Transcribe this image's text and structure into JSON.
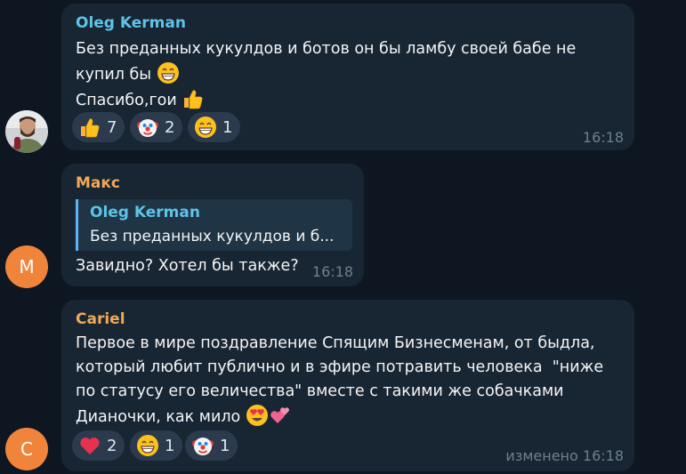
{
  "messages": [
    {
      "sender": "Oleg Kerman",
      "sender_color": "#5ec3e8",
      "lines": [
        "Без преданных кукулдов и ботов он бы ламбу своей бабе не",
        "купил бы",
        "Спасибо,гои"
      ],
      "time": "16:18",
      "avatar": "photo",
      "reactions": [
        {
          "icon": "thumbs-up",
          "count": "7"
        },
        {
          "icon": "clown-face",
          "count": "2"
        },
        {
          "icon": "grinning-face",
          "count": "1"
        }
      ]
    },
    {
      "sender": "Макс",
      "sender_color": "#f0a95a",
      "reply_sender": "Oleg Kerman",
      "reply_text": "Без преданных кукулдов и б...",
      "text": "Завидно? Хотел бы также?",
      "time": "16:18",
      "avatar_letter": "М"
    },
    {
      "sender": "Cariel",
      "sender_color": "#f0a95a",
      "lines": [
        "Первое в мире поздравление Спящим Бизнесменам, от быдла,",
        "который любит публично и в эфире потравить человека  \"ниже",
        "по статусу его величества\" вместе с такими же собачками",
        "Дианочки, как мило"
      ],
      "time": "изменено 16:18",
      "avatar_letter": "C",
      "reactions": [
        {
          "icon": "red-heart",
          "count": "2"
        },
        {
          "icon": "grinning-face",
          "count": "1"
        },
        {
          "icon": "clown-face",
          "count": "1"
        }
      ]
    }
  ],
  "colors": {
    "background": "#0e1621",
    "bubble": "#182533",
    "reaction_pill": "#2b3b4d",
    "avatar_orange": "#f0843a",
    "reply_accent": "#5eb5f7"
  }
}
